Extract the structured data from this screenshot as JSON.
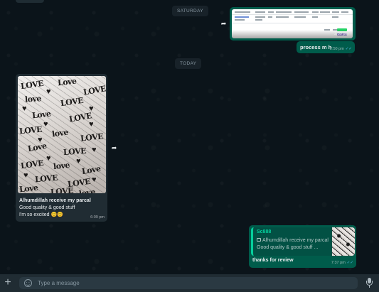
{
  "dates": {
    "saturday": "SATURDAY",
    "today": "TODAY"
  },
  "messages": {
    "screenshot_msg": {
      "text": "process m h",
      "image_time": "2:50 pm",
      "time": "2:50 pm"
    },
    "photo_msg": {
      "caption_line1": "Alhumdillah receive my parcal",
      "caption_line2": "Good quality & good stuff",
      "caption_line3": "I'm so excited 😊😊",
      "time": "6:09 pm"
    },
    "reply_msg": {
      "quote_name": "Sc888",
      "quote_line1": "Alhumdillah receive my parcal",
      "quote_line2": "Good quality & good stuff ...",
      "text": "thanks for review",
      "time": "7:37 pm"
    }
  },
  "photo_words": [
    "LOVE",
    "Love",
    "LOVE",
    "love",
    "LOVE",
    "Love",
    "LOVE",
    "LOVE",
    "love",
    "LOVE",
    "Love",
    "LOVE",
    "LOVE",
    "love",
    "Love",
    "LOVE",
    "LOVE",
    "Love",
    "LOVE",
    "love"
  ],
  "composer": {
    "placeholder": "Type a message"
  },
  "icons": {
    "forward": "forward-icon",
    "plus": "plus-icon",
    "emoji": "emoji-icon",
    "mic": "mic-icon",
    "double_tick": "double-tick-icon",
    "image": "image-icon"
  },
  "colors": {
    "background": "#0b141a",
    "outgoing_bubble": "#005c4b",
    "incoming_bubble": "#202c33",
    "accent": "#06cf9c",
    "read_tick": "#53bdeb"
  }
}
